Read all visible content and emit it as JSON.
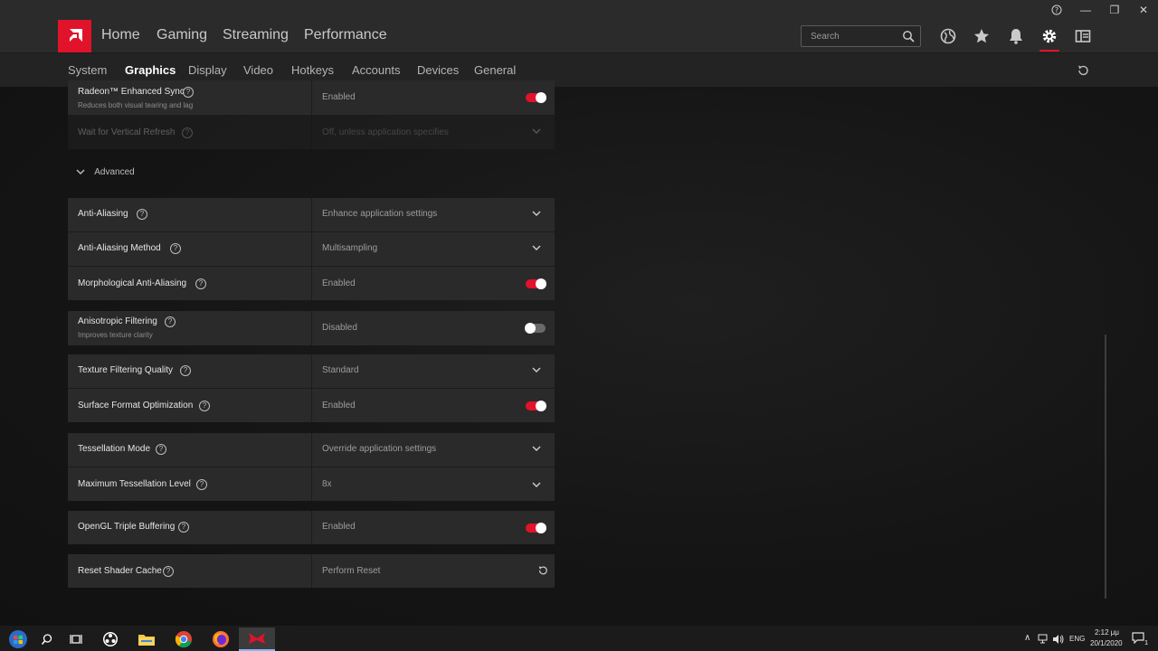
{
  "window": {
    "help": "?",
    "minimize": "—",
    "restore": "❐",
    "close": "✕"
  },
  "topnav": {
    "items": [
      {
        "label": "Home"
      },
      {
        "label": "Gaming"
      },
      {
        "label": "Streaming"
      },
      {
        "label": "Performance"
      }
    ],
    "search_placeholder": "Search"
  },
  "subnav": {
    "tabs": [
      {
        "label": "System"
      },
      {
        "label": "Graphics"
      },
      {
        "label": "Display"
      },
      {
        "label": "Video"
      },
      {
        "label": "Hotkeys"
      },
      {
        "label": "Accounts"
      },
      {
        "label": "Devices"
      },
      {
        "label": "General"
      }
    ],
    "active": "Graphics"
  },
  "settings": {
    "enhanced_sync": {
      "label": "Radeon™ Enhanced Sync",
      "sub": "Reduces both visual tearing and lag",
      "value": "Enabled"
    },
    "vsync": {
      "label": "Wait for Vertical Refresh",
      "value": "Off, unless application specifies"
    },
    "advanced": "Advanced",
    "aa": {
      "label": "Anti-Aliasing",
      "value": "Enhance application settings"
    },
    "aa_method": {
      "label": "Anti-Aliasing Method",
      "value": "Multisampling"
    },
    "mlaa": {
      "label": "Morphological Anti-Aliasing",
      "value": "Enabled"
    },
    "aniso": {
      "label": "Anisotropic Filtering",
      "sub": "Improves texture clarity",
      "value": "Disabled"
    },
    "tex_quality": {
      "label": "Texture Filtering Quality",
      "value": "Standard"
    },
    "surface": {
      "label": "Surface Format Optimization",
      "value": "Enabled"
    },
    "tess_mode": {
      "label": "Tessellation Mode",
      "value": "Override application settings"
    },
    "tess_level": {
      "label": "Maximum Tessellation Level",
      "value": "8x"
    },
    "ogl_triple": {
      "label": "OpenGL Triple Buffering",
      "value": "Enabled"
    },
    "shader_cache": {
      "label": "Reset Shader Cache",
      "value": "Perform Reset"
    }
  },
  "taskbar": {
    "lang": "ENG",
    "time": "2:12 μμ",
    "date": "20/1/2020",
    "notif_count": "1"
  },
  "colors": {
    "accent": "#e0132b",
    "panel": "#2a2a2a"
  }
}
